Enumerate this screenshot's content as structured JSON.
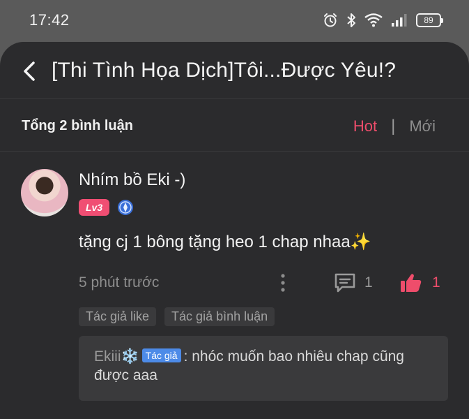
{
  "status_bar": {
    "time": "17:42",
    "battery": "89",
    "icons": [
      "alarm-icon",
      "bluetooth-icon",
      "wifi-icon",
      "signal-icon",
      "battery-icon"
    ]
  },
  "header": {
    "title": "[Thi Tình Họa Dịch]Tôi...Được Yêu!?"
  },
  "comments_bar": {
    "count_label": "Tổng 2 bình luận",
    "sort_hot": "Hot",
    "sort_separator": "|",
    "sort_new": "Mới",
    "active_sort": "Hot"
  },
  "comment": {
    "username": "Nhím bồ Eki -)",
    "level": "Lv3",
    "content": "tặng cj 1 bông tặng heo 1 chap nhaa✨",
    "time_ago": "5 phút trước",
    "reply_count": "1",
    "like_count": "1",
    "tags": [
      "Tác giả like",
      "Tác giả bình luận"
    ],
    "reply": {
      "author": "Ekiii❄️",
      "author_tag": "Tác giả",
      "text": ": nhóc muốn bao nhiêu chap cũng được aaa"
    }
  },
  "colors": {
    "accent": "#ee4d6b",
    "background": "#2b2b2d",
    "author_tag": "#4d8be8"
  }
}
